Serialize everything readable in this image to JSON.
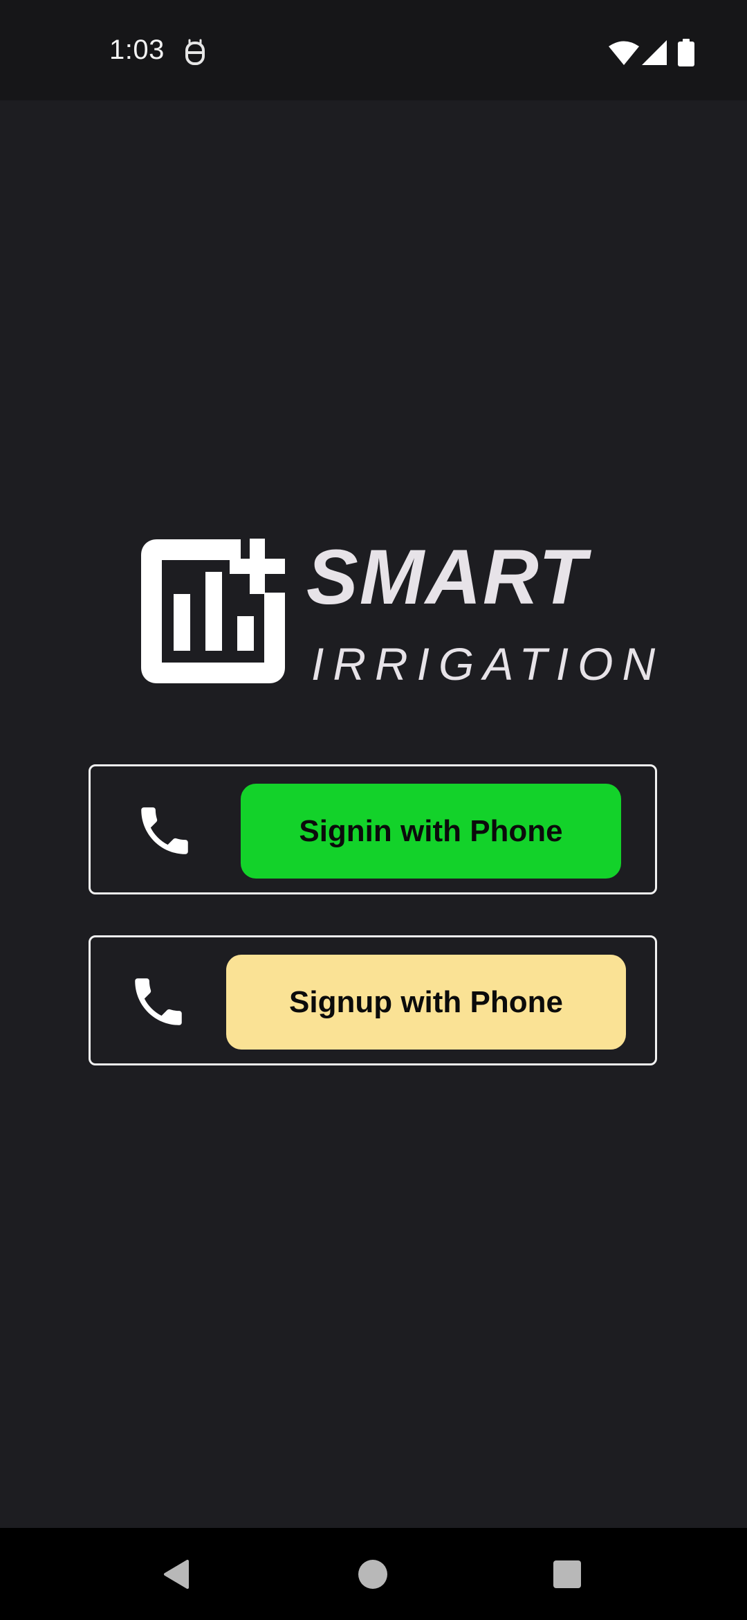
{
  "status_bar": {
    "time": "1:03",
    "icons": [
      "app-notification-icon",
      "wifi-icon",
      "signal-icon",
      "battery-icon"
    ]
  },
  "logo": {
    "title": "SMART",
    "subtitle": "IRRIGATION",
    "mark_icon": "analytics-plus-icon"
  },
  "auth": {
    "signin_label": "Signin with Phone",
    "signup_label": "Signup with Phone",
    "icon": "phone-icon"
  },
  "nav_bar": {
    "icons": [
      "back-icon",
      "home-icon",
      "recents-icon"
    ]
  },
  "colors": {
    "background": "#1d1d21",
    "status_bar": "#161618",
    "signin_button": "#13d22a",
    "signup_button": "#fae295",
    "text_light": "#e7e3e8",
    "nav_bar": "#000000"
  }
}
